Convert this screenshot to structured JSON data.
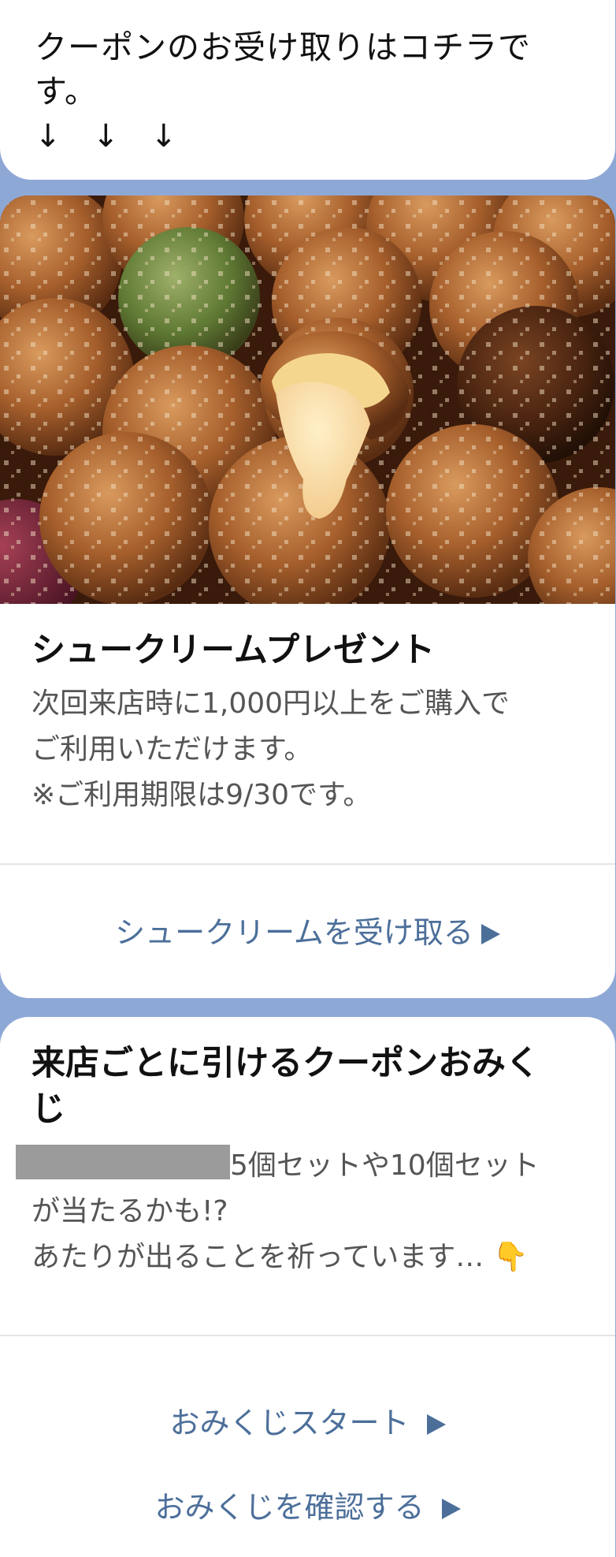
{
  "intro": {
    "message_line1": "クーポンのお受け取りはコチラで",
    "message_line2": "す。",
    "arrows": "↓　↓　↓"
  },
  "cream_puff": {
    "image_alt": "cream-puffs-photo",
    "title": "シュークリームプレゼント",
    "desc_line1": "次回来店時に1,000円以上をご購入で",
    "desc_line2": "ご利用いただけます。",
    "desc_line3": "※ご利用期限は9/30です。",
    "receive_label": "シュークリームを受け取る"
  },
  "omikuji": {
    "title_line1": "来店ごとに引けるクーポンおみく",
    "title_line2": "じ",
    "desc_line1": "5個セットや10個セット",
    "desc_line2": "が当たるかも!?",
    "desc_line3": "あたりが出ることを祈っています…",
    "emoji": "👇",
    "start_label": "おみくじスタート",
    "confirm_label": "おみくじを確認する"
  },
  "colors": {
    "background": "#8ea8d6",
    "link": "#4c6f9a"
  }
}
